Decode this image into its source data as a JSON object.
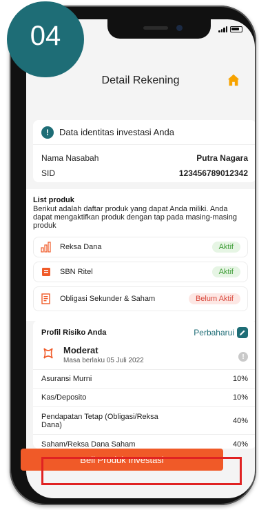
{
  "step_badge": "04",
  "header": {
    "title": "Detail Rekening",
    "home_icon": "home-icon"
  },
  "identity": {
    "title": "Data identitas investasi Anda",
    "rows": [
      {
        "label": "Nama Nasabah",
        "value": "Putra Nagara"
      },
      {
        "label": "SID",
        "value": "123456789012342"
      }
    ]
  },
  "products": {
    "heading": "List produk",
    "description": "Berikut adalah daftar produk yang dapat Anda miliki. Anda dapat mengaktifkan produk dengan tap pada masing-masing produk",
    "items": [
      {
        "name": "Reksa Dana",
        "status": "Aktif",
        "icon": "chart-bars-icon"
      },
      {
        "name": "SBN Ritel",
        "status": "Aktif",
        "icon": "book-icon"
      },
      {
        "name": "Obligasi Sekunder & Saham",
        "status": "Belum Aktif",
        "icon": "document-icon"
      }
    ]
  },
  "risk": {
    "title": "Profil Risiko Anda",
    "update_label": "Perbaharui",
    "level": "Moderat",
    "valid_until": "Masa berlaku 05 Juli 2022",
    "allocations": [
      {
        "label": "Asuransi Murni",
        "value": "10%"
      },
      {
        "label": "Kas/Deposito",
        "value": "10%"
      },
      {
        "label": "Pendapatan Tetap (Obligasi/Reksa Dana)",
        "value": "40%"
      },
      {
        "label": "Saham/Reksa Dana Saham",
        "value": "40%"
      }
    ]
  },
  "cta": {
    "label": "Beli Produk Investasi"
  },
  "colors": {
    "brand": "#1e6d76",
    "cta": "#f05a28",
    "active": "#3d9b35",
    "inactive": "#d8473b",
    "highlight": "#e02222"
  }
}
